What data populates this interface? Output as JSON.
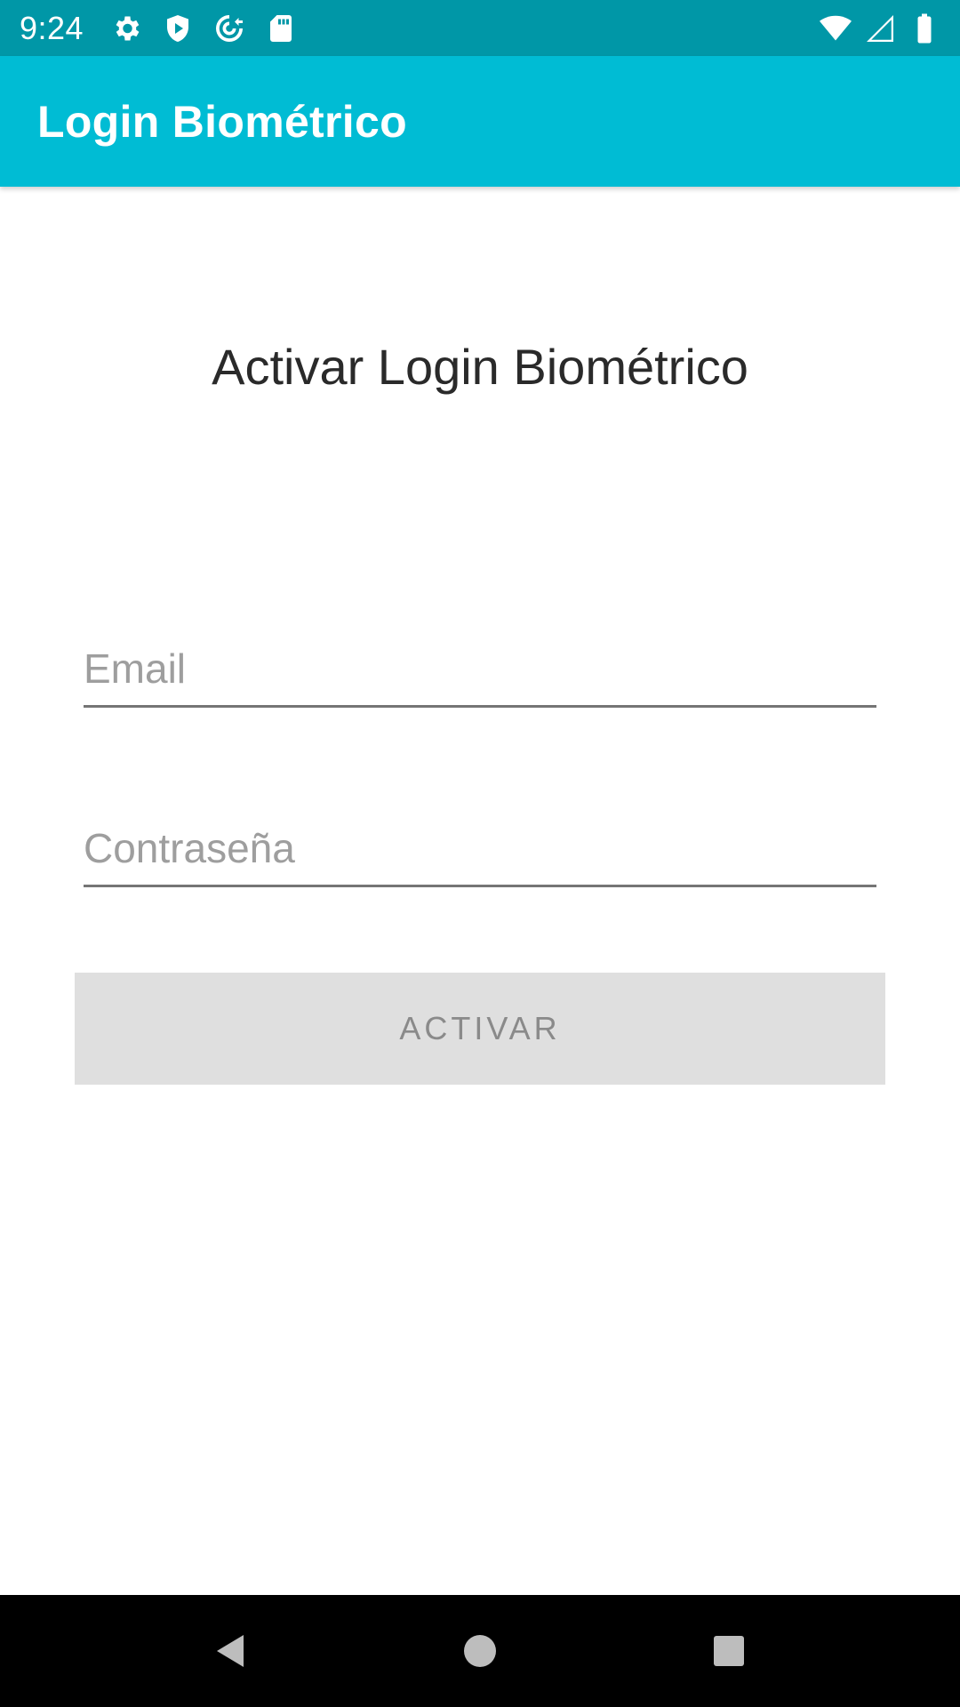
{
  "status_bar": {
    "time": "9:24",
    "left_icons": [
      "gear-icon",
      "shield-play-icon",
      "at-sync-icon",
      "sd-card-icon"
    ],
    "right_icons": [
      "wifi-icon",
      "cell-signal-icon",
      "battery-icon"
    ],
    "background": "#0097a7"
  },
  "app_bar": {
    "title": "Login Biométrico",
    "background": "#00bcd4"
  },
  "main": {
    "heading": "Activar Login Biométrico",
    "email": {
      "value": "",
      "placeholder": "Email"
    },
    "password": {
      "value": "",
      "placeholder": "Contraseña"
    },
    "activate_button": "ACTIVAR"
  },
  "nav_bar": {
    "buttons": [
      "back-icon",
      "home-icon",
      "recents-icon"
    ]
  }
}
